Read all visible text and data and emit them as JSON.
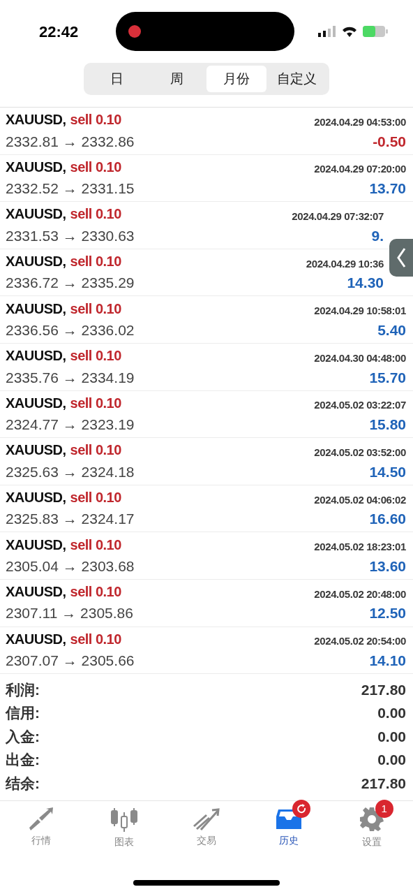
{
  "status_bar": {
    "time": "22:42"
  },
  "period_tabs": [
    {
      "label": "日",
      "selected": false
    },
    {
      "label": "周",
      "selected": false
    },
    {
      "label": "月份",
      "selected": true
    },
    {
      "label": "自定义",
      "selected": false
    }
  ],
  "trades": [
    {
      "symbol": "XAUUSD,",
      "side": "sell 0.10",
      "prices": "2332.81 → 2332.86",
      "time": "2024.04.29 04:53:00",
      "profit": "-0.50",
      "color": "#c0272d",
      "covered": false
    },
    {
      "symbol": "XAUUSD,",
      "side": "sell 0.10",
      "prices": "2332.52 → 2331.15",
      "time": "2024.04.29 07:20:00",
      "profit": "13.70",
      "color": "#1f63b8",
      "covered": false
    },
    {
      "symbol": "XAUUSD,",
      "side": "sell 0.10",
      "prices": "2331.53 → 2330.63",
      "time": "2024.04.29 07:32:07",
      "profit": "9.",
      "color": "#1f63b8",
      "covered": true
    },
    {
      "symbol": "XAUUSD,",
      "side": "sell 0.10",
      "prices": "2336.72 → 2335.29",
      "time": "2024.04.29 10:36",
      "profit": "14.30",
      "color": "#1f63b8",
      "covered": true
    },
    {
      "symbol": "XAUUSD,",
      "side": "sell 0.10",
      "prices": "2336.56 → 2336.02",
      "time": "2024.04.29 10:58:01",
      "profit": "5.40",
      "color": "#1f63b8",
      "covered": false
    },
    {
      "symbol": "XAUUSD,",
      "side": "sell 0.10",
      "prices": "2335.76 → 2334.19",
      "time": "2024.04.30 04:48:00",
      "profit": "15.70",
      "color": "#1f63b8",
      "covered": false
    },
    {
      "symbol": "XAUUSD,",
      "side": "sell 0.10",
      "prices": "2324.77 → 2323.19",
      "time": "2024.05.02 03:22:07",
      "profit": "15.80",
      "color": "#1f63b8",
      "covered": false
    },
    {
      "symbol": "XAUUSD,",
      "side": "sell 0.10",
      "prices": "2325.63 → 2324.18",
      "time": "2024.05.02 03:52:00",
      "profit": "14.50",
      "color": "#1f63b8",
      "covered": false
    },
    {
      "symbol": "XAUUSD,",
      "side": "sell 0.10",
      "prices": "2325.83 → 2324.17",
      "time": "2024.05.02 04:06:02",
      "profit": "16.60",
      "color": "#1f63b8",
      "covered": false
    },
    {
      "symbol": "XAUUSD,",
      "side": "sell 0.10",
      "prices": "2305.04 → 2303.68",
      "time": "2024.05.02 18:23:01",
      "profit": "13.60",
      "color": "#1f63b8",
      "covered": false
    },
    {
      "symbol": "XAUUSD,",
      "side": "sell 0.10",
      "prices": "2307.11 → 2305.86",
      "time": "2024.05.02 20:48:00",
      "profit": "12.50",
      "color": "#1f63b8",
      "covered": false
    },
    {
      "symbol": "XAUUSD,",
      "side": "sell 0.10",
      "prices": "2307.07 → 2305.66",
      "time": "2024.05.02 20:54:00",
      "profit": "14.10",
      "color": "#1f63b8",
      "covered": false
    }
  ],
  "summary": [
    {
      "label": "利润:",
      "value": "217.80"
    },
    {
      "label": "信用:",
      "value": "0.00"
    },
    {
      "label": "入金:",
      "value": "0.00"
    },
    {
      "label": "出金:",
      "value": "0.00"
    },
    {
      "label": "结余:",
      "value": "217.80"
    }
  ],
  "nav": [
    {
      "kind": "quotes",
      "label": "行情",
      "selected": false
    },
    {
      "kind": "chart",
      "label": "图表",
      "selected": false
    },
    {
      "kind": "trade",
      "label": "交易",
      "selected": false
    },
    {
      "kind": "history",
      "label": "历史",
      "selected": true,
      "badge": {
        "kind": "refresh"
      }
    },
    {
      "kind": "settings",
      "label": "设置",
      "selected": false,
      "badge": {
        "kind": "count",
        "text": "1"
      }
    }
  ]
}
